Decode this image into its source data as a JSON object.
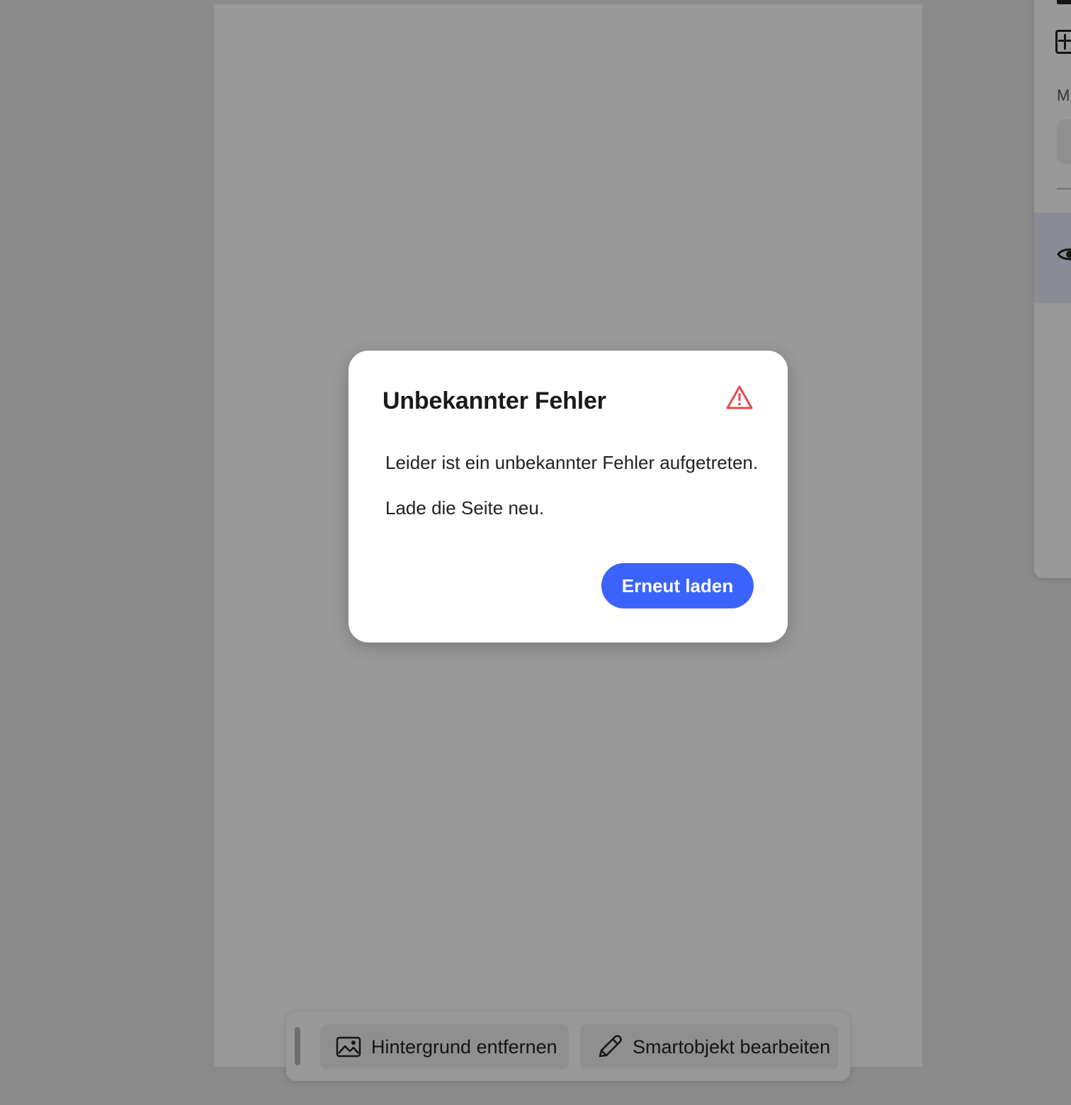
{
  "right_panel": {
    "section_label": "M"
  },
  "toolbar": {
    "remove_background_label": "Hintergrund entfernen",
    "edit_smart_object_label": "Smartobjekt bearbeiten"
  },
  "dialog": {
    "title": "Unbekannter Fehler",
    "message_line_1": "Leider ist ein unbekannter Fehler aufgetreten.",
    "message_line_2": "Lade die Seite neu.",
    "reload_button_label": "Erneut laden",
    "warning_color": "#e34850",
    "button_color": "#3b63fb"
  },
  "icons": {
    "warning": "warning-icon",
    "image": "image-icon",
    "pencil": "pencil-icon",
    "eye": "eye-icon",
    "add": "add-icon"
  }
}
